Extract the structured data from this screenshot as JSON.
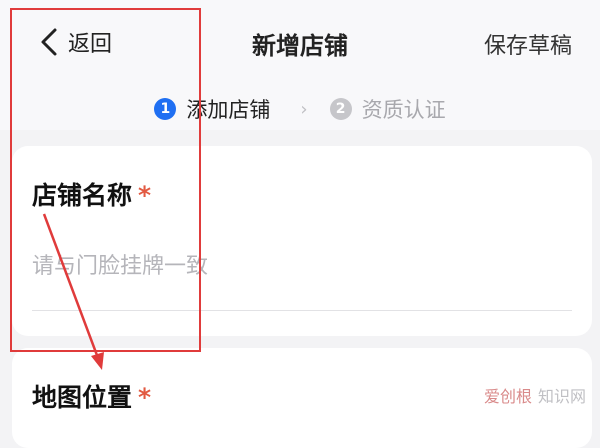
{
  "header": {
    "back_label": "返回",
    "title": "新增店铺",
    "save_draft_label": "保存草稿"
  },
  "steps": [
    {
      "number": "1",
      "label": "添加店铺",
      "active": true
    },
    {
      "number": "2",
      "label": "资质认证",
      "active": false
    }
  ],
  "step_separator": "›",
  "form": {
    "store_name": {
      "label": "店铺名称",
      "required_mark": "*",
      "placeholder": "请与门脸挂牌一致",
      "value": ""
    },
    "map_location": {
      "label": "地图位置",
      "required_mark": "*"
    }
  },
  "watermark": {
    "part1": "爱创根",
    "part2": "知识网"
  },
  "colors": {
    "accent": "#1f6ff2",
    "required": "#e25a42",
    "annotation": "#e03b3b"
  }
}
